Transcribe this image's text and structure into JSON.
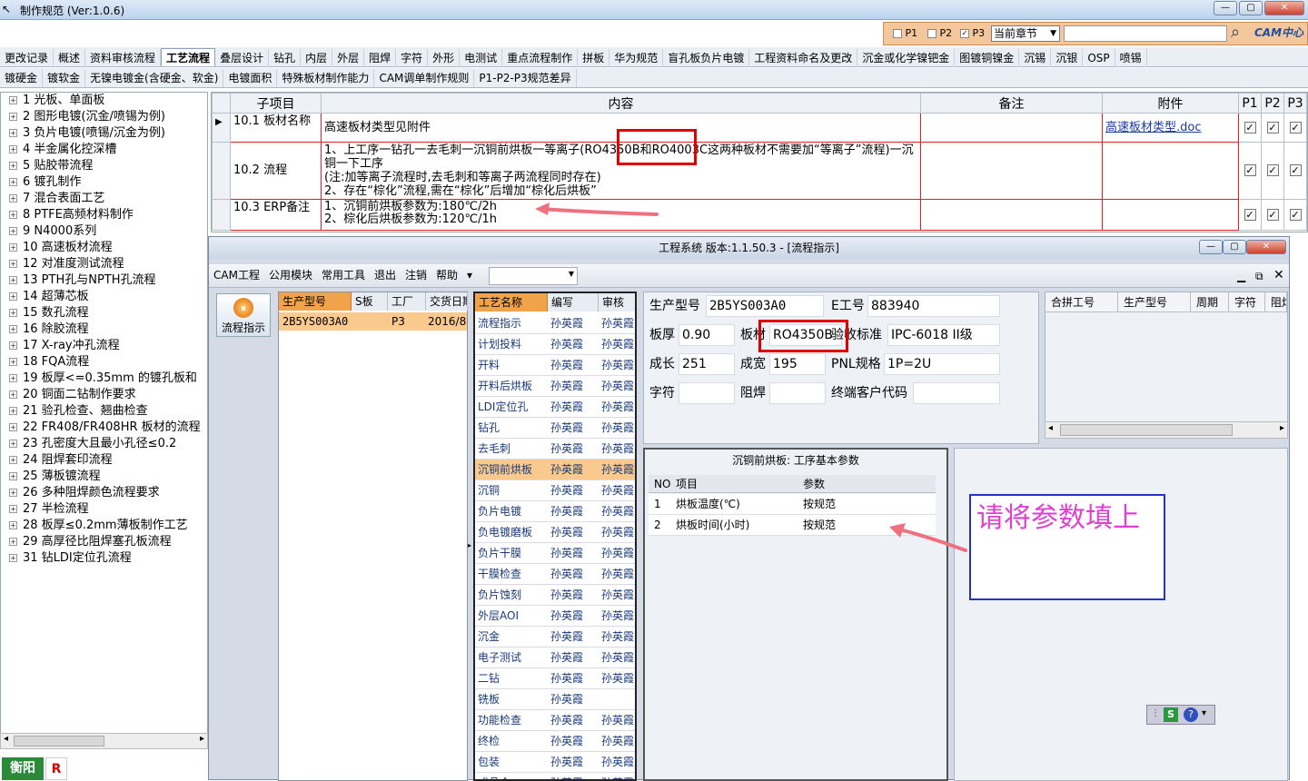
{
  "app": {
    "title": "制作规范 (Ver:1.0.6)"
  },
  "controls": {
    "p1": "P1",
    "p2": "P2",
    "p3": "P3",
    "p3_checked": true,
    "chapter_select": "当前章节",
    "logo": "CAM中心"
  },
  "tabs_row1": [
    "更改记录",
    "概述",
    "资料审核流程",
    "工艺流程",
    "叠层设计",
    "钻孔",
    "内层",
    "外层",
    "阻焊",
    "字符",
    "外形",
    "电测试",
    "重点流程制作",
    "拼板",
    "华为规范",
    "盲孔板负片电镀",
    "工程资料命名及更改",
    "沉金或化学镍钯金",
    "图镀铜镍金",
    "沉锡",
    "沉银",
    "OSP",
    "喷锡"
  ],
  "active_tab_index": 3,
  "tabs_row2": [
    "镀硬金",
    "镀软金",
    "无镍电镀金(含硬金、软金)",
    "电镀面积",
    "特殊板材制作能力",
    "CAM调单制作规则",
    "P1-P2-P3规范差异"
  ],
  "tree": [
    "1 光板、单面板",
    "2 图形电镀(沉金/喷锡为例)",
    "3 负片电镀(喷锡/沉金为例)",
    "4 半金属化控深槽",
    "5 贴胶带流程",
    "6 镀孔制作",
    "7 混合表面工艺",
    "8 PTFE高频材料制作",
    "9 N4000系列",
    "10 高速板材流程",
    "12 对准度测试流程",
    "13 PTH孔与NPTH孔流程",
    "14 超薄芯板",
    "15 数孔流程",
    "16 除胶流程",
    "17 X-ray冲孔流程",
    "18 FQA流程",
    "19 板厚<=0.35mm 的镀孔板和",
    "20 铜面二钻制作要求",
    "21 验孔检查、翘曲检查",
    "22 FR408/FR408HR 板材的流程",
    "23 孔密度大且最小孔径≤0.2",
    "24 阻焊套印流程",
    "25 薄板镀流程",
    "26 多种阻焊颜色流程要求",
    "27 半检流程",
    "28 板厚≤0.2mm薄板制作工艺",
    "29 高厚径比阻焊塞孔板流程",
    "31 钻LDI定位孔流程"
  ],
  "grid": {
    "headers": {
      "sub": "子项目",
      "content": "内容",
      "remark": "备注",
      "attach": "附件",
      "p1": "P1",
      "p2": "P2",
      "p3": "P3"
    },
    "rows": [
      {
        "sub": "10.1 板材名称",
        "content": "高速板材类型见附件",
        "remark": "",
        "attach": "高速板材类型.doc"
      },
      {
        "sub": "10.2 流程",
        "content": "1、上工序一钻孔一去毛刺一沉铜前烘板一等离子(RO4350B和RO4003C这两种板材不需要加“等离子”流程)一沉铜一下工序\n(注:加等离子流程时,去毛刺和等离子两流程同时存在)\n2、存在“棕化”流程,需在“棕化”后增加“棕化后烘板”",
        "remark": "",
        "attach": ""
      },
      {
        "sub": "10.3 ERP备注",
        "content": "1、沉铜前烘板参数为:180℃/2h\n2、棕化后烘板参数为:120℃/1h",
        "remark": "",
        "attach": ""
      }
    ]
  },
  "win2": {
    "title": "工程系统 版本:1.1.50.3 - [流程指示]",
    "menu": [
      "CAM工程",
      "公用模块",
      "常用工具",
      "退出",
      "注销",
      "帮助"
    ],
    "flow_button": "流程指示",
    "prod_headers": [
      "生产型号",
      "S板",
      "工厂",
      "交货日期"
    ],
    "prod_row": {
      "model": "2B5YS003A0",
      "factory": "P3",
      "date": "2016/8"
    },
    "proc_headers": [
      "工艺名称",
      "编写",
      "审核"
    ],
    "processes": [
      {
        "name": "流程指示",
        "writer": "孙英霞",
        "reviewer": "孙英霞"
      },
      {
        "name": "计划投料",
        "writer": "孙英霞",
        "reviewer": "孙英霞"
      },
      {
        "name": "开料",
        "writer": "孙英霞",
        "reviewer": "孙英霞"
      },
      {
        "name": "开料后烘板",
        "writer": "孙英霞",
        "reviewer": "孙英霞"
      },
      {
        "name": "LDI定位孔",
        "writer": "孙英霞",
        "reviewer": "孙英霞"
      },
      {
        "name": "钻孔",
        "writer": "孙英霞",
        "reviewer": "孙英霞"
      },
      {
        "name": "去毛刺",
        "writer": "孙英霞",
        "reviewer": "孙英霞"
      },
      {
        "name": "沉铜前烘板",
        "writer": "孙英霞",
        "reviewer": "孙英霞"
      },
      {
        "name": "沉铜",
        "writer": "孙英霞",
        "reviewer": "孙英霞"
      },
      {
        "name": "负片电镀",
        "writer": "孙英霞",
        "reviewer": "孙英霞"
      },
      {
        "name": "负电镀磨板",
        "writer": "孙英霞",
        "reviewer": "孙英霞"
      },
      {
        "name": "负片干膜",
        "writer": "孙英霞",
        "reviewer": "孙英霞"
      },
      {
        "name": "干膜检查",
        "writer": "孙英霞",
        "reviewer": "孙英霞"
      },
      {
        "name": "负片蚀刻",
        "writer": "孙英霞",
        "reviewer": "孙英霞"
      },
      {
        "name": "外层AOI",
        "writer": "孙英霞",
        "reviewer": "孙英霞"
      },
      {
        "name": "沉金",
        "writer": "孙英霞",
        "reviewer": "孙英霞"
      },
      {
        "name": "电子测试",
        "writer": "孙英霞",
        "reviewer": "孙英霞"
      },
      {
        "name": "二钻",
        "writer": "孙英霞",
        "reviewer": "孙英霞"
      },
      {
        "name": "铣板",
        "writer": "孙英霞",
        "reviewer": ""
      },
      {
        "name": "功能检查",
        "writer": "孙英霞",
        "reviewer": "孙英霞"
      },
      {
        "name": "终检",
        "writer": "孙英霞",
        "reviewer": "孙英霞"
      },
      {
        "name": "包装",
        "writer": "孙英霞",
        "reviewer": "孙英霞"
      },
      {
        "name": "成品仓",
        "writer": "孙英霞",
        "reviewer": "孙英霞"
      }
    ],
    "selected_process_index": 7,
    "info": {
      "model_label": "生产型号",
      "model": "2B5YS003A0",
      "eno_label": "E工号",
      "eno": "883940",
      "thick_label": "板厚",
      "thick": "0.90",
      "material_label": "板材",
      "material": "RO4350B",
      "std_label": "验收标准",
      "std": "IPC-6018 II级",
      "len_label": "成长",
      "len": "251",
      "wid_label": "成宽",
      "wid": "195",
      "pnl_label": "PNL规格",
      "pnl": "1P=2U",
      "char_label": "字符",
      "char": "",
      "mask_label": "阻焊",
      "mask": "",
      "client_label": "终端客户代码",
      "client": ""
    },
    "merge_headers": [
      "合拼工号",
      "生产型号",
      "周期",
      "字符",
      "阻焊"
    ],
    "param": {
      "title": "沉铜前烘板: 工序基本参数",
      "headers": [
        "NO",
        "项目",
        "参数"
      ],
      "rows": [
        {
          "no": "1",
          "item": "烘板温度(℃)",
          "value": "按规范"
        },
        {
          "no": "2",
          "item": "烘板时间(小时)",
          "value": "按规范"
        }
      ]
    },
    "note": "请将参数填上"
  },
  "bottom": {
    "company": "衡阳",
    "badge": "R"
  },
  "colors": {
    "annotation_red": "#e00000",
    "note_text": "#e040d0",
    "note_border": "#2830c8",
    "arrow": "#f07080"
  }
}
